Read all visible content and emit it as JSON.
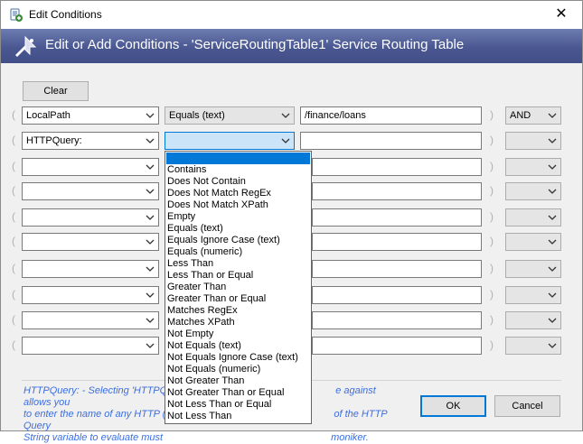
{
  "window": {
    "title": "Edit Conditions",
    "close_glyph": "✕",
    "banner_title": "Edit or Add Conditions - 'ServiceRoutingTable1' Service Routing Table"
  },
  "toolbar": {
    "clear_label": "Clear"
  },
  "rows": [
    {
      "field": "LocalPath",
      "operator": "Equals (text)",
      "value": "/finance/loans",
      "logic": "AND"
    },
    {
      "field": "HTTPQuery:",
      "operator": "",
      "value": "",
      "logic": ""
    },
    {
      "field": "",
      "operator": "",
      "value": "",
      "logic": ""
    },
    {
      "field": "",
      "operator": "",
      "value": "",
      "logic": ""
    },
    {
      "field": "",
      "operator": "",
      "value": "",
      "logic": ""
    },
    {
      "field": "",
      "operator": "",
      "value": "",
      "logic": ""
    },
    {
      "field": "",
      "operator": "",
      "value": "",
      "logic": ""
    },
    {
      "field": "",
      "operator": "",
      "value": "",
      "logic": ""
    },
    {
      "field": "",
      "operator": "",
      "value": "",
      "logic": ""
    },
    {
      "field": "",
      "operator": "",
      "value": "",
      "logic": ""
    }
  ],
  "operator_options": [
    "Contains",
    "Does Not Contain",
    "Does Not Match RegEx",
    "Does Not Match XPath",
    "Empty",
    "Equals (text)",
    "Equals Ignore Case (text)",
    "Equals (numeric)",
    "Less Than",
    "Less Than or Equal",
    "Greater Than",
    "Greater Than or Equal",
    "Matches RegEx",
    "Matches XPath",
    "Not Empty",
    "Not Equals (text)",
    "Not Equals Ignore Case (text)",
    "Not Equals (numeric)",
    "Not Greater Than",
    "Not Greater Than or Equal",
    "Not Less Than or Equal",
    "Not Less Than"
  ],
  "help": {
    "line1": "HTTPQuery: - Selecting 'HTTPQ",
    "line1_tail": "e against allows you",
    "line2": "to enter the name of any HTTP (",
    "line2_tail": "of the HTTP Query",
    "line3": "String variable to evaluate must",
    "line3_tail": "moniker."
  },
  "buttons": {
    "ok_label": "OK",
    "cancel_label": "Cancel"
  },
  "colors": {
    "banner": "#4a5791",
    "selection": "#0078d7",
    "help_text": "#3c6ee0"
  },
  "icons": {
    "app": "app-icon",
    "banner": "banner-icon",
    "chevron": "chevron-down-icon"
  }
}
